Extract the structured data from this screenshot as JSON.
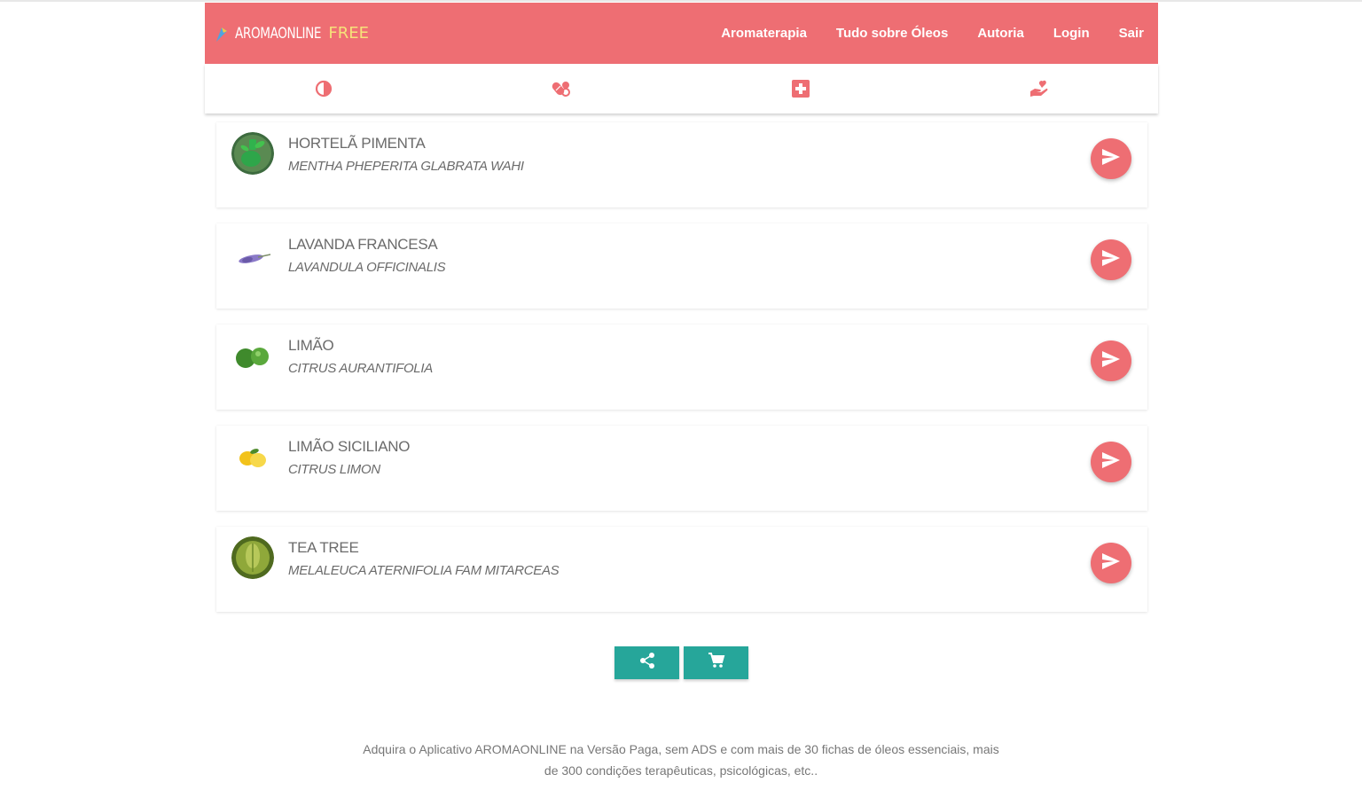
{
  "brand": {
    "name": "AROMAONLINE",
    "tag": "FREE"
  },
  "nav": {
    "links": [
      "Aromaterapia",
      "Tudo sobre Óleos",
      "Autoria",
      "Login",
      "Sair"
    ]
  },
  "tabs": [
    {
      "icon": "drop-icon"
    },
    {
      "icon": "pills-icon"
    },
    {
      "icon": "medical-cross-icon"
    },
    {
      "icon": "heart-hand-icon"
    }
  ],
  "oils": [
    {
      "name": "HORTELÃ PIMENTA",
      "scientific": "MENTHA PHEPERITA GLABRATA WAHI",
      "image": "peppermint-image"
    },
    {
      "name": "LAVANDA FRANCESA",
      "scientific": "LAVANDULA OFFICINALIS",
      "image": "lavender-image"
    },
    {
      "name": "LIMÃO",
      "scientific": "CITRUS AURANTIFOLIA",
      "image": "lime-image"
    },
    {
      "name": "LIMÃO SICILIANO",
      "scientific": "CITRUS LIMON",
      "image": "lemon-image"
    },
    {
      "name": "TEA TREE",
      "scientific": "MELALEUCA ATERNIFOLIA FAM MITARCEAS",
      "image": "tea-tree-image"
    }
  ],
  "actions": [
    {
      "icon": "share-icon"
    },
    {
      "icon": "cart-icon"
    }
  ],
  "footer": {
    "text": "Adquira o Aplicativo AROMAONLINE na Versão Paga, sem ADS e com mais de 30 fichas de óleos essenciais, mais de 300 condições terapêuticas, psicológicas, etc.."
  },
  "colors": {
    "primary": "#ee6e73",
    "accent": "#26a69a",
    "text": "#6b6b6b"
  }
}
